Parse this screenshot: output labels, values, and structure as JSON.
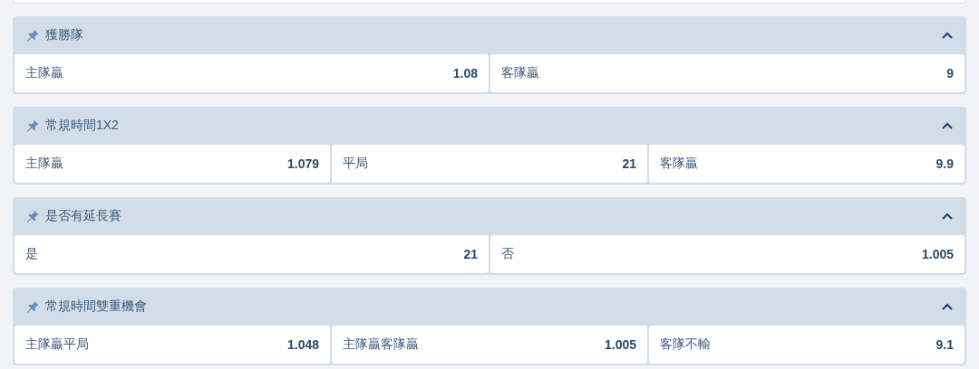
{
  "markets": [
    {
      "title": "獲勝隊",
      "expanded": true,
      "odds": [
        {
          "label": "主隊贏",
          "value": "1.08"
        },
        {
          "label": "客隊贏",
          "value": "9"
        }
      ]
    },
    {
      "title": "常規時間1X2",
      "expanded": true,
      "odds": [
        {
          "label": "主隊贏",
          "value": "1.079"
        },
        {
          "label": "平局",
          "value": "21"
        },
        {
          "label": "客隊贏",
          "value": "9.9"
        }
      ]
    },
    {
      "title": "是否有延長賽",
      "expanded": true,
      "odds": [
        {
          "label": "是",
          "value": "21"
        },
        {
          "label": "否",
          "value": "1.005"
        }
      ]
    },
    {
      "title": "常規時間雙重機會",
      "expanded": true,
      "odds": [
        {
          "label": "主隊贏平局",
          "value": "1.048"
        },
        {
          "label": "主隊贏客隊贏",
          "value": "1.005"
        },
        {
          "label": "客隊不輸",
          "value": "9.1"
        }
      ]
    }
  ]
}
